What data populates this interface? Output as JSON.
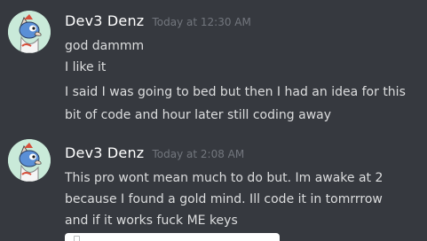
{
  "messages": [
    {
      "username": "Dev3 Denz",
      "timestamp": "Today at 12:30 AM",
      "lines": [
        "god dammm",
        "I like it",
        "I said I was going to bed but then I had an idea for this",
        "bit of code and hour later still coding away"
      ]
    },
    {
      "username": "Dev3 Denz",
      "timestamp": "Today at 2:08 AM",
      "lines": [
        "This pro wont mean much to do but. Im awake at 2",
        "because I found a gold mind. Ill code it in tomrrrow",
        "and if it works fuck ME keys"
      ]
    }
  ],
  "icons": {
    "avatar": "avatar-icon",
    "attachment": "file-icon"
  },
  "colors": {
    "background": "#36393f",
    "username": "#ffffff",
    "timestamp": "#72767d",
    "message_text": "#dcddde"
  }
}
